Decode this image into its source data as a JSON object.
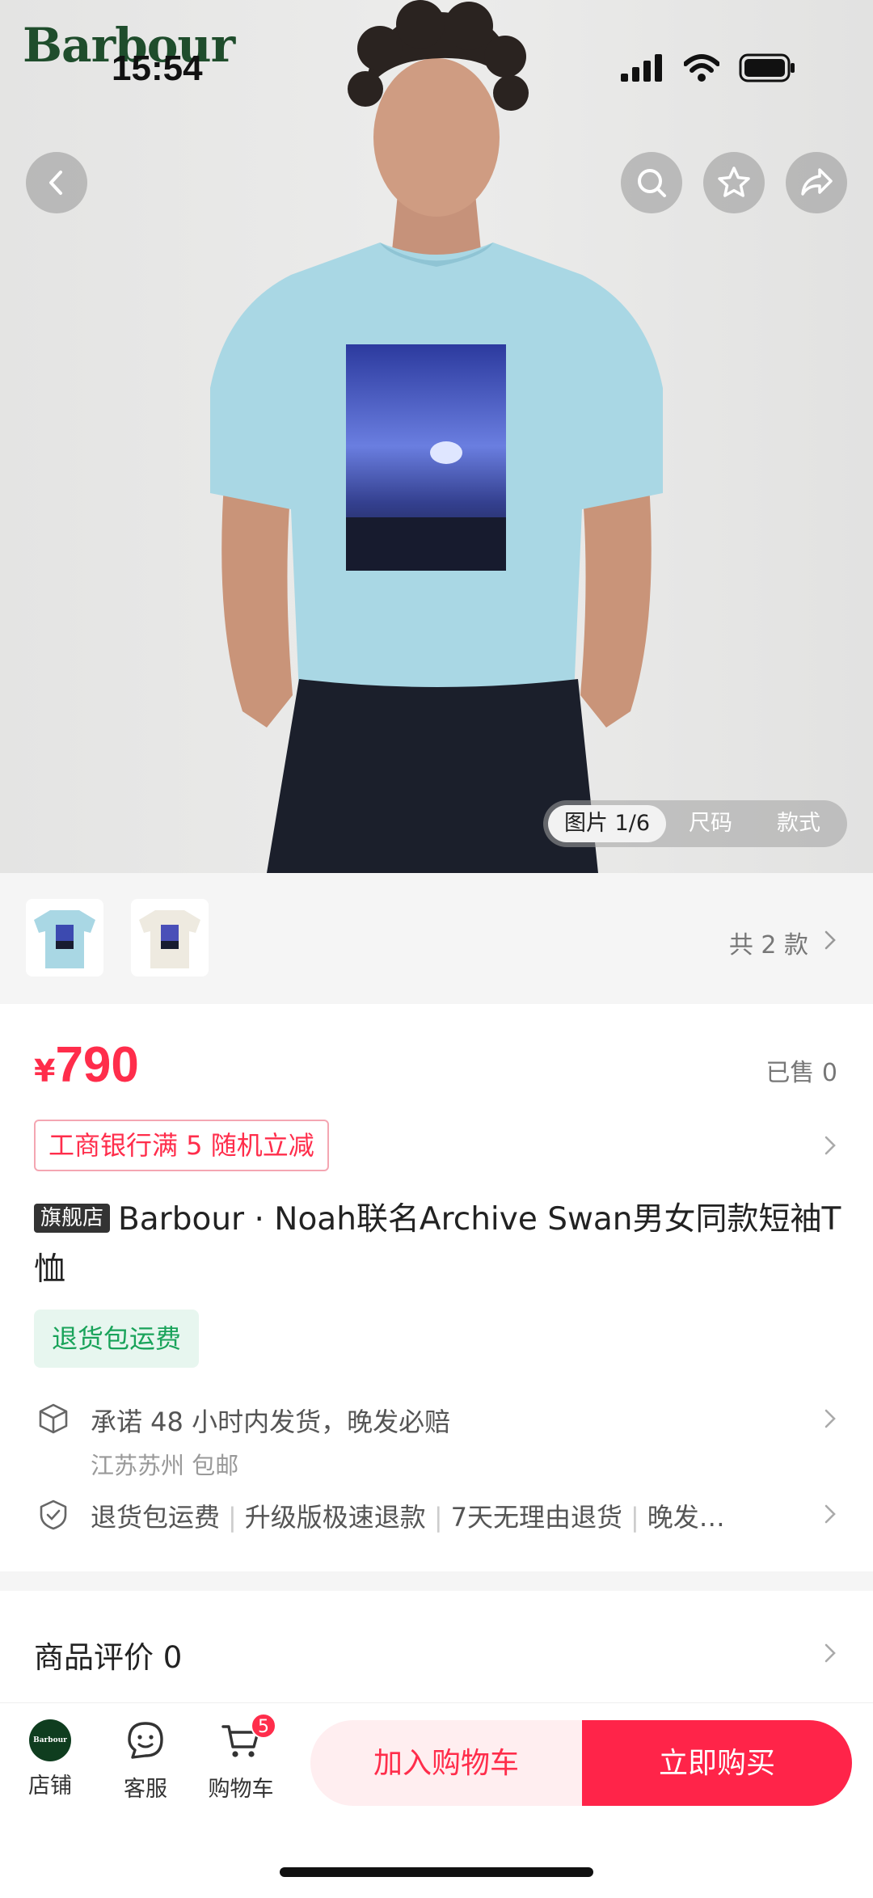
{
  "status_bar": {
    "time": "15:54"
  },
  "brand": {
    "logo_text": "Barbour"
  },
  "top_actions": {
    "back_icon": "chevron-left-icon",
    "search_icon": "search-icon",
    "favorite_icon": "star-icon",
    "share_icon": "share-icon"
  },
  "media": {
    "tabs": [
      {
        "label": "图片 1/6",
        "active": true
      },
      {
        "label": "尺码"
      },
      {
        "label": "款式"
      }
    ]
  },
  "variants": {
    "count_label": "共 2 款",
    "thumbs": [
      "light-blue",
      "cream"
    ]
  },
  "price": {
    "currency": "¥",
    "value": "790"
  },
  "sold": "已售 0",
  "promo": "工商银行满 5 随机立减",
  "title": {
    "badge": "旗舰店",
    "text": "Barbour · Noah联名Archive Swan男女同款短袖T恤"
  },
  "return_tag": "退货包运费",
  "services": [
    {
      "icon": "box-icon",
      "text": "承诺 48 小时内发货，晚发必赔",
      "sub": "江苏苏州 包邮"
    },
    {
      "icon": "shield-check-icon",
      "items": [
        "退货包运费",
        "升级版极速退款",
        "7天无理由退货",
        "晚发…"
      ]
    }
  ],
  "reviews": {
    "label": "商品评价 0"
  },
  "bottom_bar": {
    "store": {
      "label": "店铺",
      "avatar_text": "Barbour"
    },
    "service": {
      "label": "客服"
    },
    "cart": {
      "label": "购物车",
      "badge": "5"
    },
    "add_to_cart": "加入购物车",
    "buy_now": "立即购买"
  },
  "colors": {
    "accent": "#ff2d4b",
    "brand_green": "#1f4d2c",
    "tag_green": "#19a35a",
    "shirt": "#a9d7e4"
  }
}
